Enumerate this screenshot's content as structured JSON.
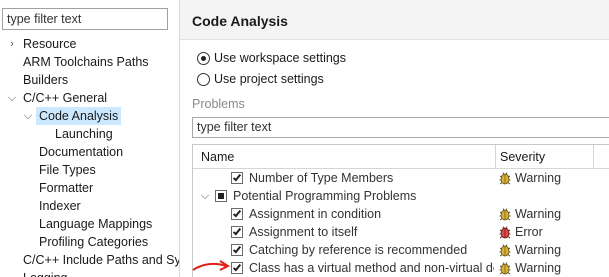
{
  "nav": {
    "filter_placeholder": "type filter text",
    "items": [
      {
        "label": "Resource",
        "twisty": ">"
      },
      {
        "label": "ARM Toolchains Paths",
        "twisty": ""
      },
      {
        "label": "Builders",
        "twisty": ""
      },
      {
        "label": "C/C++ General",
        "twisty": "v"
      },
      {
        "label": "Code Analysis",
        "twisty": "v"
      },
      {
        "label": "Launching",
        "twisty": ""
      },
      {
        "label": "Documentation",
        "twisty": ""
      },
      {
        "label": "File Types",
        "twisty": ""
      },
      {
        "label": "Formatter",
        "twisty": ""
      },
      {
        "label": "Indexer",
        "twisty": ""
      },
      {
        "label": "Language Mappings",
        "twisty": ""
      },
      {
        "label": "Profiling Categories",
        "twisty": ""
      },
      {
        "label": "C/C++ Include Paths and Sy",
        "twisty": ""
      },
      {
        "label": "Logging",
        "twisty": ""
      }
    ]
  },
  "page": {
    "title": "Code Analysis",
    "radio_workspace": "Use workspace settings",
    "radio_project": "Use project settings",
    "selected": "workspace"
  },
  "problems": {
    "group_label": "Problems",
    "filter_placeholder": "type filter text",
    "col_name": "Name",
    "col_severity": "Severity",
    "rows": [
      {
        "name": "Number of Type Members",
        "severity": "Warning",
        "kind": "warning"
      },
      {
        "name": "Potential Programming Problems",
        "severity": "",
        "kind": "category"
      },
      {
        "name": "Assignment in condition",
        "severity": "Warning",
        "kind": "warning"
      },
      {
        "name": "Assignment to itself",
        "severity": "Error",
        "kind": "error"
      },
      {
        "name": "Catching by reference is recommended",
        "severity": "Warning",
        "kind": "warning"
      },
      {
        "name": "Class has a virtual method and non-virtual des",
        "severity": "Warning",
        "kind": "warning"
      }
    ]
  },
  "colors": {
    "selection": "#cce8ff",
    "warning_bug": "#c9a227",
    "error_bug": "#d23c3c",
    "annotation_arrow": "#e0201a"
  }
}
